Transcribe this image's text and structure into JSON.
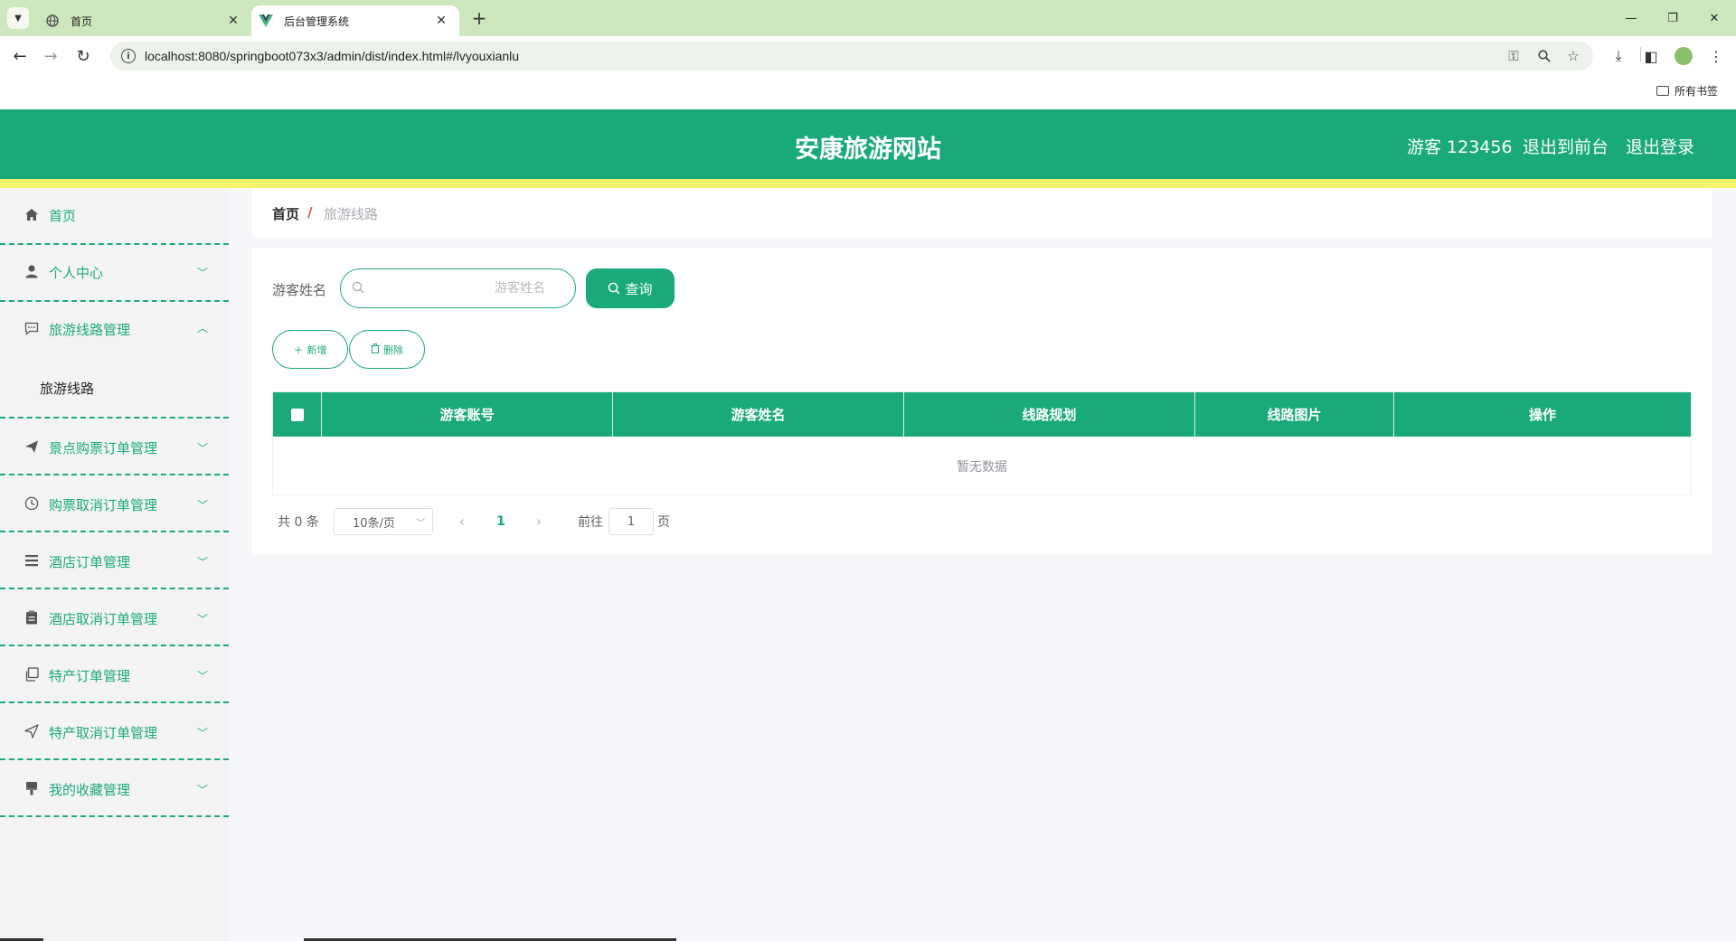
{
  "browser": {
    "tabs": [
      {
        "title": "首页",
        "active": false
      },
      {
        "title": "后台管理系统",
        "active": true
      }
    ],
    "new_tab": "+",
    "url": "localhost:8080/springboot073x3/admin/dist/index.html#/lvyouxianlu",
    "bookmarks_label": "所有书签",
    "window_controls": [
      "minimize-icon",
      "restore-icon",
      "close-icon"
    ],
    "colors": {
      "tabbar": "#cde8bf",
      "active_tab": "#ffffff"
    }
  },
  "header": {
    "title": "安康旅游网站",
    "user_label": "游客 123456",
    "back_to_front": "退出到前台",
    "logout": "退出登录",
    "colors": {
      "bar": "#1aaa7a",
      "stripe": "#f6f36a"
    }
  },
  "sidebar": {
    "items": [
      {
        "label": "首页",
        "icon": "home-icon",
        "arrow": ""
      },
      {
        "label": "个人中心",
        "icon": "user-icon",
        "arrow": "﹀"
      },
      {
        "label": "旅游线路管理",
        "icon": "chat-icon",
        "arrow": "︿",
        "expanded": true
      },
      {
        "label": "景点购票订单管理",
        "icon": "send-icon",
        "arrow": "﹀"
      },
      {
        "label": "购票取消订单管理",
        "icon": "clock-icon",
        "arrow": "﹀"
      },
      {
        "label": "酒店订单管理",
        "icon": "list-icon",
        "arrow": "﹀"
      },
      {
        "label": "酒店取消订单管理",
        "icon": "clipboard-icon",
        "arrow": "﹀"
      },
      {
        "label": "特产订单管理",
        "icon": "copy-icon",
        "arrow": "﹀"
      },
      {
        "label": "特产取消订单管理",
        "icon": "paper-plane-icon",
        "arrow": "﹀"
      },
      {
        "label": "我的收藏管理",
        "icon": "brush-icon",
        "arrow": "﹀"
      }
    ],
    "sub_item": "旅游线路",
    "accent": "#1aaa7a"
  },
  "breadcrumb": {
    "home": "首页",
    "separator": "/",
    "current": "旅游线路"
  },
  "search": {
    "label": "游客姓名",
    "value": "",
    "placeholder": "游客姓名",
    "button": "查询"
  },
  "actions": {
    "add": "新增",
    "delete": "删除"
  },
  "table": {
    "columns": [
      "游客账号",
      "游客姓名",
      "线路规划",
      "线路图片",
      "操作"
    ],
    "rows": [],
    "empty_text": "暂无数据",
    "header_color": "#1aaa7a"
  },
  "pagination": {
    "total": "共 0 条",
    "page_size": "10条/页",
    "current_page": "1",
    "goto_prefix": "前往",
    "goto_value": "1",
    "goto_suffix": "页"
  }
}
